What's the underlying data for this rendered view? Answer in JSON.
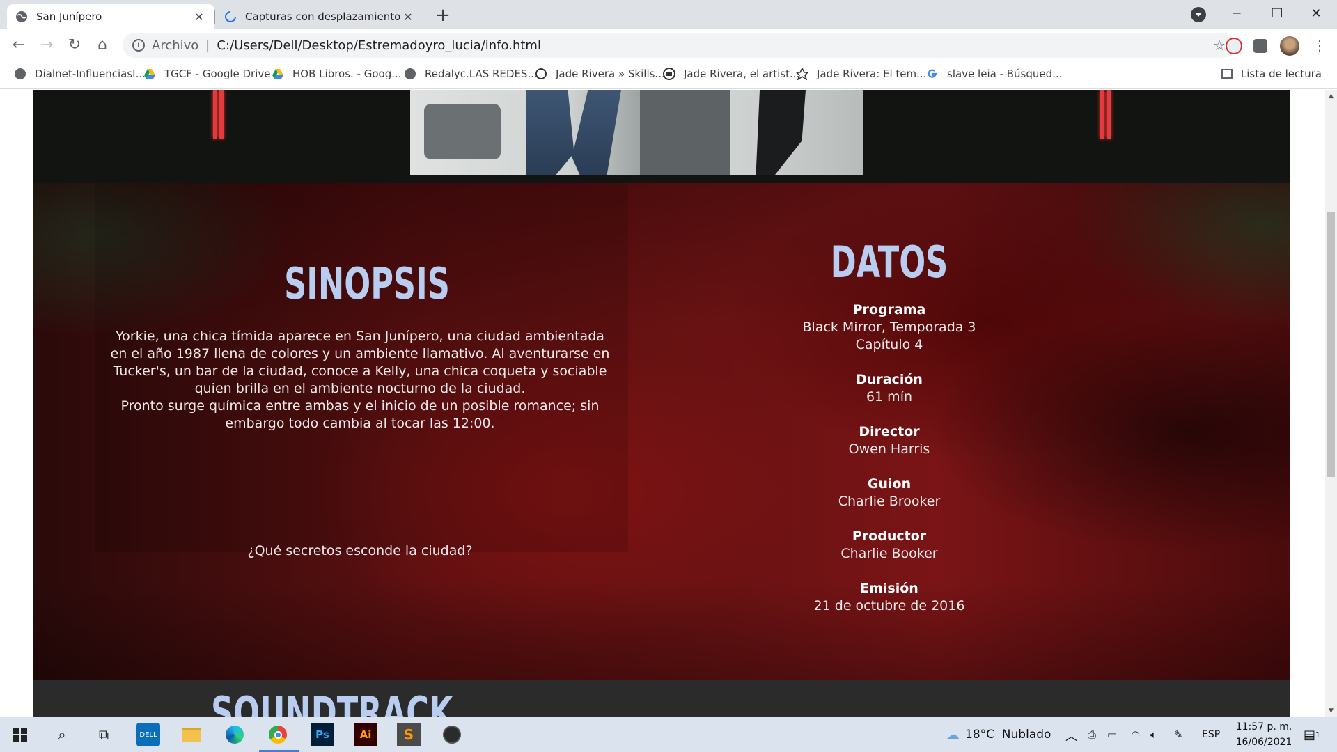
{
  "browser": {
    "tabs": [
      {
        "title": "San Junípero",
        "active": true
      },
      {
        "title": "Capturas con desplazamiento para",
        "active": false
      }
    ],
    "address": {
      "scheme": "Archivo",
      "url": "C:/Users/Dell/Desktop/Estremadoyro_lucia/info.html"
    },
    "bookmarks": [
      "Dialnet-InfluenciasI...",
      "TGCF - Google Drive",
      "HOB Libros. - Goog...",
      "Redalyc.LAS REDES...",
      "Jade Rivera » Skills...",
      "Jade Rivera, el artist...",
      "Jade Rivera: El tem...",
      "slave leia - Búsqued..."
    ],
    "reading_list": "Lista de lectura"
  },
  "page": {
    "sinopsis": {
      "title": "SINOPSIS",
      "paragraph1": "Yorkie, una chica tímida aparece en San Junípero, una ciudad ambientada en el año 1987 llena de colores y un ambiente llamativo. Al aventurarse en Tucker's, un bar de la ciudad, conoce a Kelly, una chica coqueta y sociable quien brilla en el ambiente nocturno de la ciudad.",
      "paragraph2": "Pronto surge química entre ambas y el inicio de un posible romance; sin embargo todo cambia al tocar las 12:00.",
      "question": "¿Qué secretos esconde la ciudad?"
    },
    "datos": {
      "title": "DATOS",
      "items": [
        {
          "label": "Programa",
          "value": "Black Mirror, Temporada 3 Capítulo 4"
        },
        {
          "label": "Duración",
          "value": "61 mín"
        },
        {
          "label": "Director",
          "value": "Owen Harris"
        },
        {
          "label": "Guion",
          "value": "Charlie Brooker"
        },
        {
          "label": "Productor",
          "value": "Charlie Booker"
        },
        {
          "label": "Emisión",
          "value": "21 de octubre de 2016"
        }
      ]
    },
    "soundtrack": {
      "title": "SOUNDTRACK"
    }
  },
  "taskbar": {
    "weather": "18°C  Nublado",
    "language": "ESP",
    "time": "11:57 p. m.",
    "date": "16/06/2021",
    "notifications": "1"
  },
  "colors": {
    "heading": "#b9cdf0",
    "accent_red": "#e33c3c",
    "section_bg": "#5a0f10",
    "taskbar_bg": "#dbe3ee"
  }
}
